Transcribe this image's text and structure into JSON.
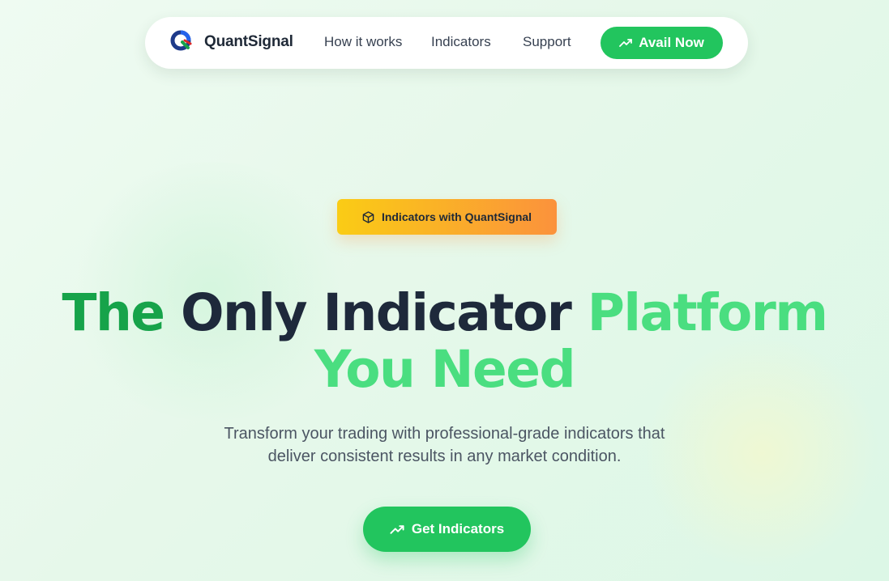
{
  "nav": {
    "brand": "QuantSignal",
    "links": [
      "How it works",
      "Indicators",
      "Support"
    ],
    "cta_label": "Avail Now",
    "cta_icon": "trending-up-icon"
  },
  "hero": {
    "badge_icon": "box-icon",
    "badge_label": "Indicators with QuantSignal",
    "headline": {
      "part1": "The",
      "part2": "Only Indicator",
      "part3": "Platform",
      "part4": "You Need"
    },
    "subtitle_line1": "Transform your trading with professional-grade indicators that",
    "subtitle_line2": "deliver consistent results in any market condition.",
    "cta_label": "Get Indicators",
    "cta_icon": "trending-up-icon"
  },
  "colors": {
    "accent_green": "#22c55e",
    "dark_green": "#16a34a",
    "light_green": "#4ade80",
    "badge_gradient_start": "#facc15",
    "badge_gradient_end": "#fb923c",
    "text_dark": "#1e293b"
  }
}
